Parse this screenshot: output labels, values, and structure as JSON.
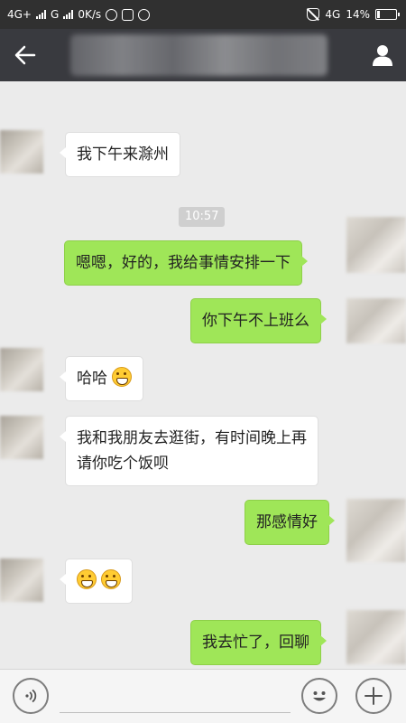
{
  "status_bar": {
    "network_1": "4G+",
    "network_2": "G",
    "speed": "0K/s",
    "network_3": "4G",
    "battery_label": "14%",
    "battery_level": 0.14,
    "icons": [
      "signal-icon",
      "signal-icon",
      "qq-icon",
      "gallery-icon",
      "chat-icon",
      "mute-icon",
      "battery-icon"
    ]
  },
  "header": {
    "back_icon": "arrow-left-icon",
    "contact_icon": "person-icon"
  },
  "messages": [
    {
      "side": "in",
      "text": "我下午来滁州"
    },
    {
      "type": "time",
      "text": "10:57"
    },
    {
      "side": "out",
      "text": "嗯嗯，好的，我给事情安排一下"
    },
    {
      "side": "out",
      "text": "你下午不上班么"
    },
    {
      "side": "in",
      "text": "哈哈",
      "emoji": "grin-emoji"
    },
    {
      "side": "in",
      "text_line1": "我和我朋友去逛街，有时间晚上再",
      "text_line2": "请你吃个饭呗"
    },
    {
      "side": "out",
      "text": "那感情好"
    },
    {
      "side": "in",
      "emoji": "grin-emoji",
      "count": 2
    },
    {
      "side": "out",
      "text": "我去忙了，回聊"
    }
  ],
  "input_bar": {
    "voice_icon": "voice-icon",
    "emoji_icon": "smiley-icon",
    "plus_icon": "plus-icon",
    "input_value": ""
  },
  "colors": {
    "header_bg": "#393a3f",
    "chat_bg": "#ebebeb",
    "outgoing_bubble": "#9fe658",
    "incoming_bubble": "#ffffff"
  }
}
